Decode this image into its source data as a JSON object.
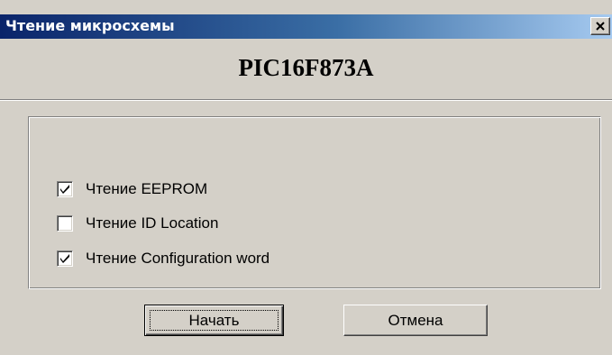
{
  "window": {
    "title": "Чтение микросхемы",
    "close_glyph": "close-icon"
  },
  "chip": {
    "name": "PIC16F873A"
  },
  "options": [
    {
      "label": "Чтение EEPROM",
      "checked": true
    },
    {
      "label": "Чтение ID Location",
      "checked": false
    },
    {
      "label": "Чтение Configuration word",
      "checked": true
    }
  ],
  "buttons": {
    "start_label": "Начать",
    "cancel_label": "Отмена"
  },
  "colors": {
    "face": "#d4d0c8",
    "title_active_start": "#0a246a",
    "title_active_end": "#a6caf0"
  }
}
